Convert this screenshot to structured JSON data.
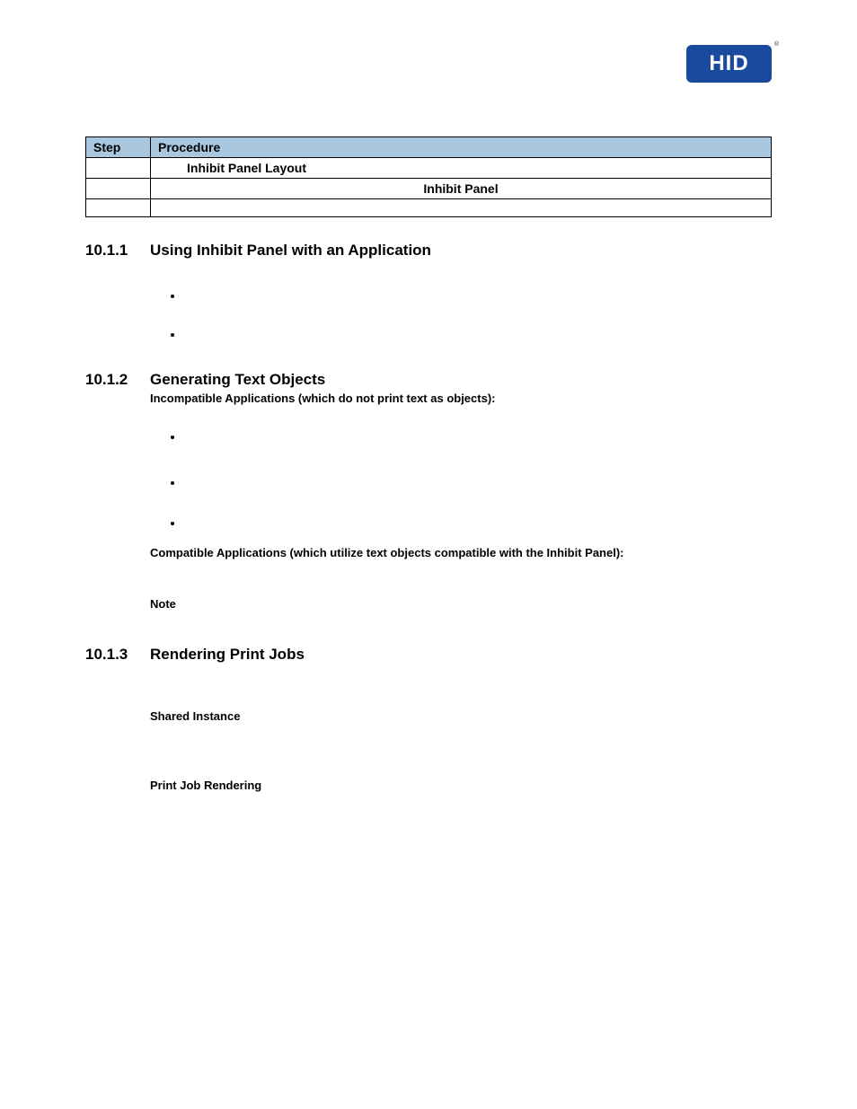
{
  "logo": {
    "text": "HID",
    "tm": "®"
  },
  "table": {
    "headers": {
      "step": "Step",
      "procedure": "Procedure"
    },
    "row1": {
      "procedure": "Inhibit Panel Layout"
    },
    "row2": {
      "procedure": "Inhibit Panel"
    }
  },
  "sections": {
    "s1": {
      "num": "10.1.1",
      "title": "Using Inhibit Panel with an Application"
    },
    "s2": {
      "num": "10.1.2",
      "title": "Generating Text Objects",
      "incompat": "Incompatible Applications (which do not print text as objects):",
      "compat": "Compatible Applications (which utilize text objects compatible with the Inhibit Panel):",
      "note": "Note"
    },
    "s3": {
      "num": "10.1.3",
      "title": "Rendering Print Jobs",
      "shared": "Shared Instance",
      "render": "Print Job Rendering"
    }
  }
}
